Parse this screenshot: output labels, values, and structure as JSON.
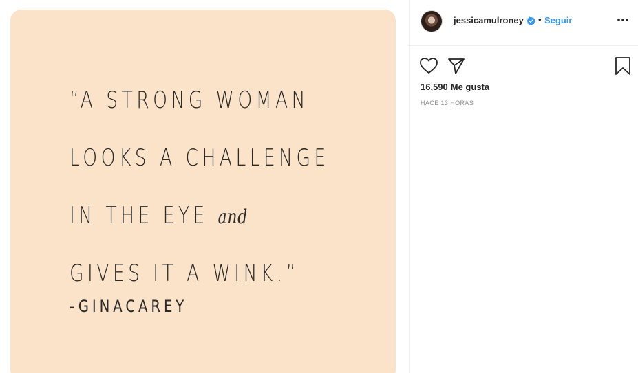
{
  "post": {
    "image": {
      "quote_lines": [
        "“A STRONG WOMAN",
        "LOOKS A CHALLENGE",
        "IN THE EYE",
        "GIVES IT A WINK.”"
      ],
      "quote_and": "and",
      "author": "-GINACAREY",
      "background_color": "#fbe3c9"
    }
  },
  "header": {
    "username": "jessicamulroney",
    "verified_icon": "verified-badge-icon",
    "separator": "•",
    "follow_label": "Seguir",
    "more_icon": "more-options-icon"
  },
  "actions": {
    "like_icon": "heart-icon",
    "share_icon": "send-icon",
    "save_icon": "bookmark-icon"
  },
  "stats": {
    "likes_count": "16,590",
    "likes_label": "Me gusta",
    "timestamp": "HACE 13 HORAS"
  },
  "colors": {
    "accent": "#3897f0",
    "text": "#262626",
    "muted": "#8e8e8e",
    "divider": "#efefef"
  }
}
